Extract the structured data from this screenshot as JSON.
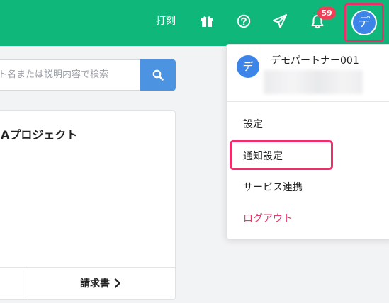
{
  "topbar": {
    "punch_label": "打刻",
    "icons": [
      "gift-icon",
      "help-icon",
      "send-icon",
      "bell-icon"
    ],
    "notification_count": "59",
    "avatar_initial": "デ",
    "background_color": "#0fb77a",
    "badge_color": "#ef3e56",
    "highlight_color": "#ee2d6a"
  },
  "search": {
    "placeholder": "ト名または説明内容で検索",
    "button_icon": "search-icon"
  },
  "project_card": {
    "title": "Aプロジェクト",
    "invoice_label": "請求書",
    "chevron_icon": "chevron-right-icon"
  },
  "user_menu": {
    "avatar_initial": "デ",
    "user_name": "デモパートナー001",
    "items": {
      "settings": "設定",
      "notification_settings": "通知設定",
      "service_integration": "サービス連携",
      "logout": "ログアウト"
    },
    "logout_color": "#e53a6b"
  }
}
